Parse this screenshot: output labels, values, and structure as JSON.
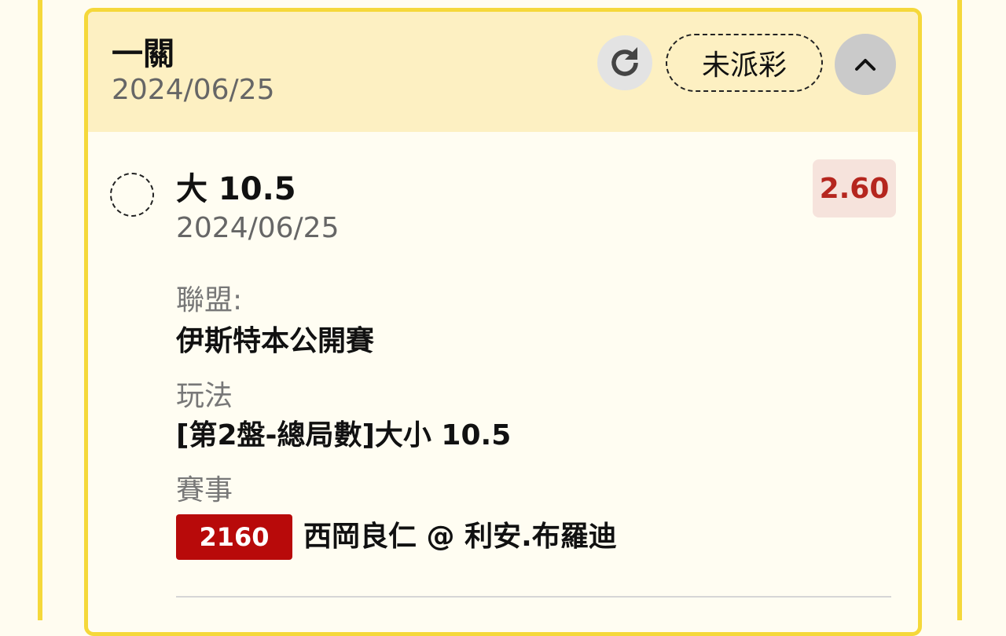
{
  "header": {
    "title": "一關",
    "date": "2024/06/25",
    "status": "未派彩",
    "refresh_icon": "refresh-icon",
    "collapse_icon": "chevron-up-icon"
  },
  "bet": {
    "title": "大 10.5",
    "date": "2024/06/25",
    "odds": "2.60",
    "league_label": "聯盟:",
    "league_value": "伊斯特本公開賽",
    "play_label": "玩法",
    "play_value": "[第2盤-總局數]大小 10.5",
    "event_label": "賽事",
    "event_code": "2160",
    "event_name": "西岡良仁 @ 利安.布羅迪"
  },
  "colors": {
    "border": "#f5d83a",
    "header_bg": "#fdf0c2",
    "odds_text": "#b5261e",
    "odds_bg": "#f6e3dc",
    "event_code_bg": "#b80a0a"
  }
}
